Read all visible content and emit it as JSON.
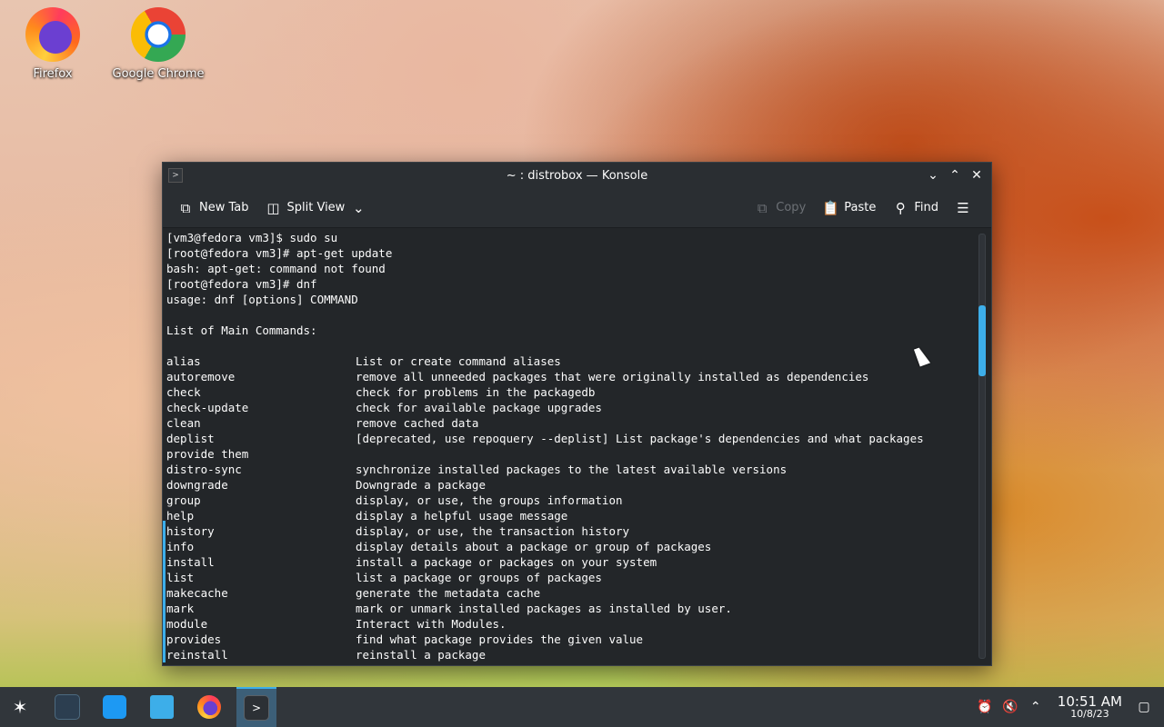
{
  "desktop": {
    "icons": [
      {
        "label": "Firefox"
      },
      {
        "label": "Google Chrome"
      }
    ]
  },
  "window": {
    "title": "~ : distrobox — Konsole",
    "toolbar": {
      "new_tab": "New Tab",
      "split_view": "Split View",
      "copy": "Copy",
      "paste": "Paste",
      "find": "Find"
    }
  },
  "terminal": {
    "lines": [
      "[vm3@fedora vm3]$ sudo su",
      "[root@fedora vm3]# apt-get update",
      "bash: apt-get: command not found",
      "[root@fedora vm3]# dnf",
      "usage: dnf [options] COMMAND",
      "",
      "List of Main Commands:",
      ""
    ],
    "commands": [
      {
        "cmd": "alias",
        "desc": "List or create command aliases"
      },
      {
        "cmd": "autoremove",
        "desc": "remove all unneeded packages that were originally installed as dependencies"
      },
      {
        "cmd": "check",
        "desc": "check for problems in the packagedb"
      },
      {
        "cmd": "check-update",
        "desc": "check for available package upgrades"
      },
      {
        "cmd": "clean",
        "desc": "remove cached data"
      },
      {
        "cmd": "deplist",
        "desc": "[deprecated, use repoquery --deplist] List package's dependencies and what packages"
      },
      {
        "cmd": "provide them",
        "desc": ""
      },
      {
        "cmd": "distro-sync",
        "desc": "synchronize installed packages to the latest available versions"
      },
      {
        "cmd": "downgrade",
        "desc": "Downgrade a package"
      },
      {
        "cmd": "group",
        "desc": "display, or use, the groups information"
      },
      {
        "cmd": "help",
        "desc": "display a helpful usage message"
      },
      {
        "cmd": "history",
        "desc": "display, or use, the transaction history"
      },
      {
        "cmd": "info",
        "desc": "display details about a package or group of packages"
      },
      {
        "cmd": "install",
        "desc": "install a package or packages on your system"
      },
      {
        "cmd": "list",
        "desc": "list a package or groups of packages"
      },
      {
        "cmd": "makecache",
        "desc": "generate the metadata cache"
      },
      {
        "cmd": "mark",
        "desc": "mark or unmark installed packages as installed by user."
      },
      {
        "cmd": "module",
        "desc": "Interact with Modules."
      },
      {
        "cmd": "provides",
        "desc": "find what package provides the given value"
      },
      {
        "cmd": "reinstall",
        "desc": "reinstall a package"
      }
    ]
  },
  "taskbar": {
    "clock_time": "10:51 AM",
    "clock_date": "10/8/23"
  },
  "colors": {
    "accent": "#3daee9",
    "panel": "#31363b",
    "terminal_bg": "#232629"
  }
}
